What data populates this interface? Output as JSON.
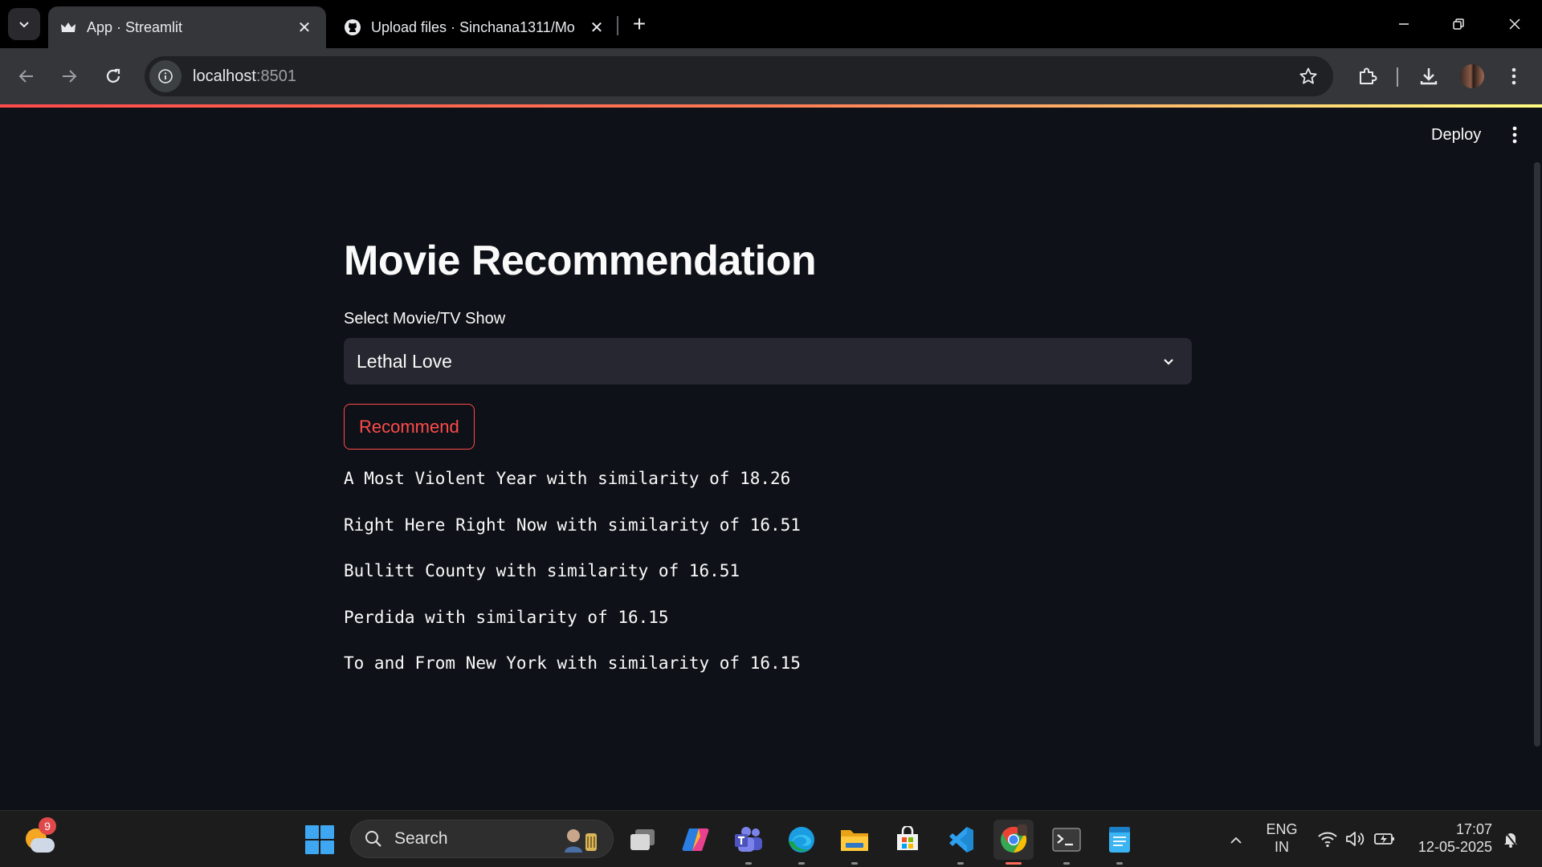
{
  "browser": {
    "tabs": [
      {
        "title": "App · Streamlit",
        "active": true
      },
      {
        "title": "Upload files · Sinchana1311/Mo",
        "active": false
      }
    ],
    "url_host": "localhost",
    "url_port": ":8501"
  },
  "header": {
    "deploy_label": "Deploy"
  },
  "main": {
    "title": "Movie Recommendation",
    "select_label": "Select Movie/TV Show",
    "select_value": "Lethal Love",
    "button_label": "Recommend",
    "results": [
      "A Most Violent Year with similarity of 18.26",
      "Right Here Right Now with similarity of 16.51",
      "Bullitt County with similarity of 16.51",
      "Perdida with similarity of 16.15",
      "To and From New York with similarity of 16.15"
    ]
  },
  "taskbar": {
    "weather_badge": "9",
    "search_placeholder": "Search",
    "lang_top": "ENG",
    "lang_bottom": "IN",
    "time": "17:07",
    "date": "12-05-2025",
    "apps": [
      "task-view",
      "copilot",
      "teams",
      "edge",
      "file-explorer",
      "microsoft-store",
      "vscode",
      "chrome",
      "terminal",
      "notepad"
    ]
  },
  "colors": {
    "app_bg": "#0e1117",
    "accent": "#ff4b4b",
    "select_bg": "#262730",
    "text": "#fafafa"
  }
}
